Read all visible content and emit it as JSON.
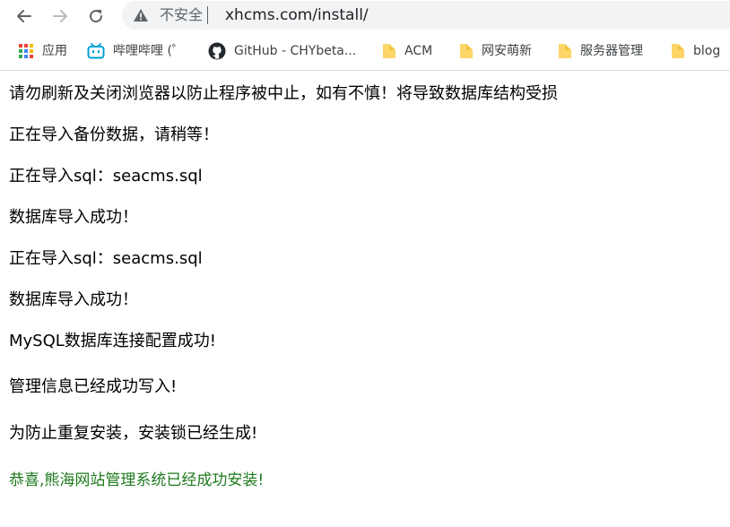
{
  "browser": {
    "security_label": "不安全",
    "url": "xhcms.com/install/"
  },
  "bookmarks": [
    {
      "label": "应用",
      "icon": "apps-grid-icon"
    },
    {
      "label": "哔哩哔哩 (゜",
      "icon": "bilibili-icon"
    },
    {
      "label": "GitHub - CHYbeta...",
      "icon": "github-icon"
    },
    {
      "label": "ACM",
      "icon": "folder-icon"
    },
    {
      "label": "网安萌新",
      "icon": "folder-icon"
    },
    {
      "label": "服务器管理",
      "icon": "folder-icon"
    },
    {
      "label": "blog",
      "icon": "folder-icon"
    }
  ],
  "content": {
    "lines": [
      "请勿刷新及关闭浏览器以防止程序被中止，如有不慎！将导致数据库结构受损",
      "正在导入备份数据，请稍等！",
      "正在导入sql：seacms.sql",
      "数据库导入成功！",
      "正在导入sql：seacms.sql",
      "数据库导入成功！",
      "MySQL数据库连接配置成功!",
      "管理信息已经成功写入!",
      "为防止重复安装，安装锁已经生成!",
      "恭喜,熊海网站管理系统已经成功安装!"
    ],
    "success_color": "#1e7a1e"
  }
}
